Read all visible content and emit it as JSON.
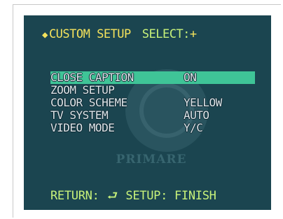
{
  "header": {
    "marker_icon": "diamond-icon",
    "title": "CUSTOM SETUP",
    "select_label": "SELECT:",
    "select_symbol": "+"
  },
  "menu": {
    "items": [
      {
        "label": "CLOSE CAPTION",
        "value": "ON",
        "selected": true
      },
      {
        "label": "ZOOM SETUP",
        "value": ""
      },
      {
        "label": "COLOR SCHEME",
        "value": "YELLOW"
      },
      {
        "label": "TV SYSTEM",
        "value": "AUTO"
      },
      {
        "label": "VIDEO MODE",
        "value": "Y/C"
      }
    ]
  },
  "footer": {
    "return_label": "RETURN:",
    "return_icon": "return-arrow-icon",
    "setup_label": "SETUP: FINISH"
  },
  "watermark": {
    "text": "PRIMARE"
  },
  "colors": {
    "background": "#1b4550",
    "highlight": "#3fc497",
    "header_accent": "#f4e25c",
    "green_text": "#c8f27a",
    "item_text": "#dfe6ea"
  }
}
